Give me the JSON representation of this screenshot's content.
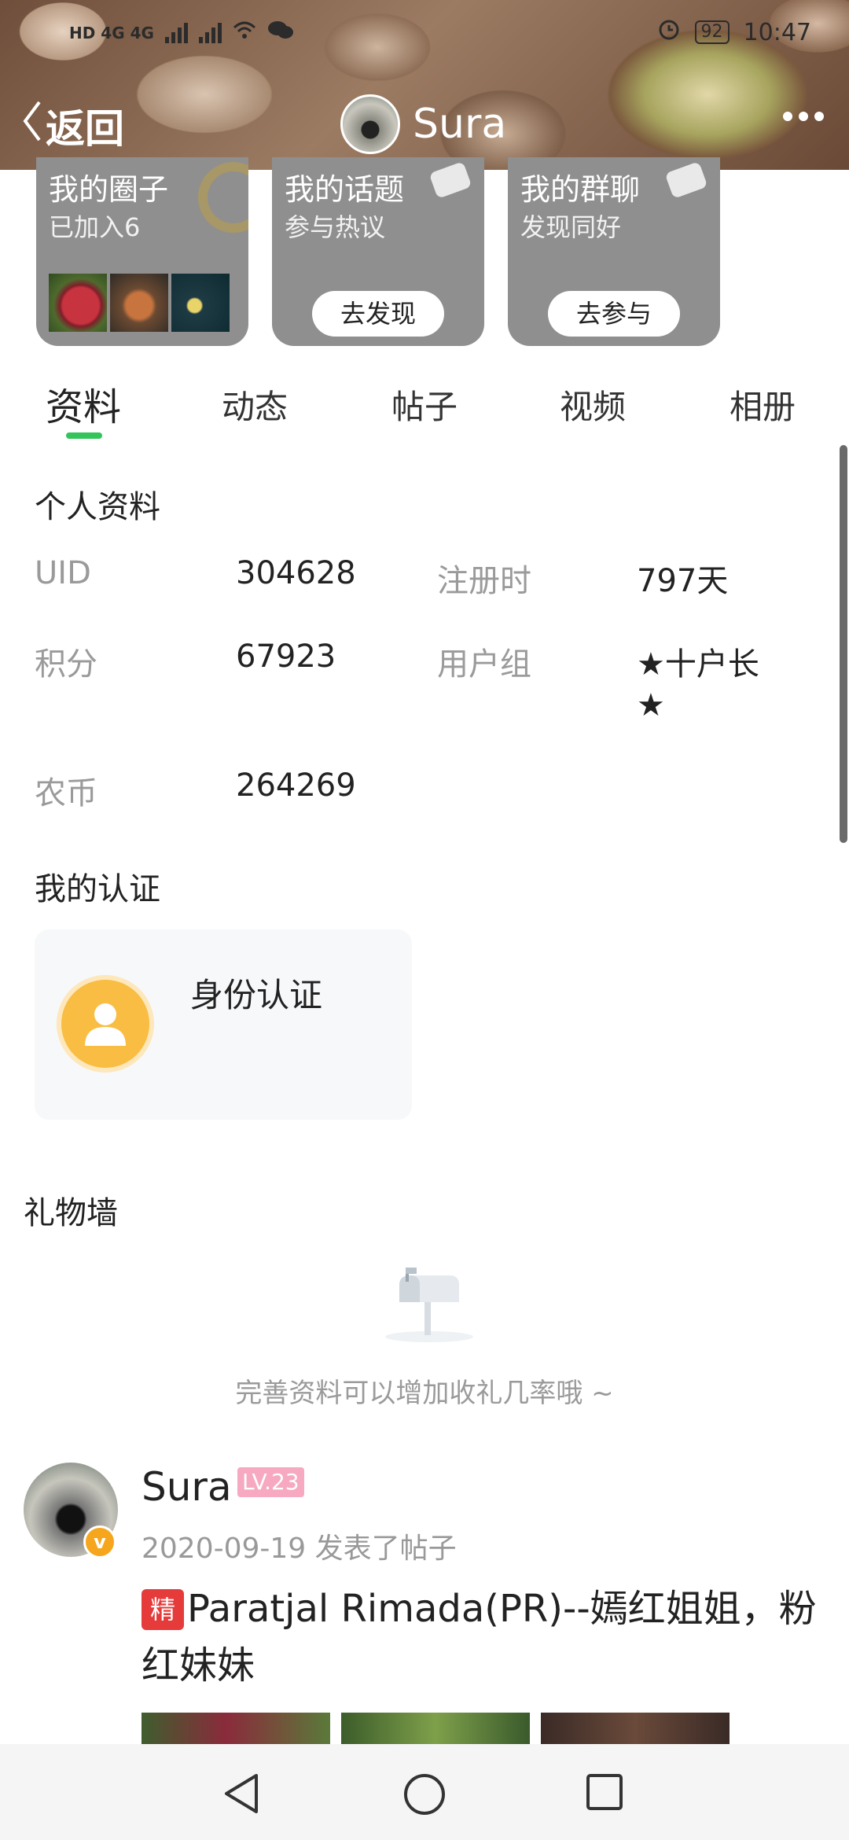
{
  "status_bar": {
    "left": "HD 4G 4G",
    "battery": "92",
    "time": "10:47"
  },
  "header": {
    "back_label": "返回",
    "username": "Sura"
  },
  "cards": [
    {
      "title": "我的圈子",
      "subtitle": "已加入6"
    },
    {
      "title": "我的话题",
      "subtitle": "参与热议",
      "button": "去发现"
    },
    {
      "title": "我的群聊",
      "subtitle": "发现同好",
      "button": "去参与"
    }
  ],
  "tabs": [
    "资料",
    "动态",
    "帖子",
    "视频",
    "相册"
  ],
  "profile": {
    "section_title": "个人资料",
    "uid_label": "UID",
    "uid_value": "304628",
    "reg_label": "注册时",
    "reg_value": "797天",
    "points_label": "积分",
    "points_value": "67923",
    "group_label": "用户组",
    "group_value_line1": "★十户长",
    "group_value_line2": "★",
    "coins_label": "农币",
    "coins_value": "264269"
  },
  "certification": {
    "section_title": "我的认证",
    "label": "身份认证"
  },
  "gift_wall": {
    "title": "礼物墙",
    "empty_text": "完善资料可以增加收礼几率哦 ~"
  },
  "post": {
    "author": "Sura",
    "level": "LV.23",
    "meta": "2020-09-19 发表了帖子",
    "tag": "精",
    "title": "Paratjal Rimada(PR)--嫣红姐姐，粉红妹妹"
  },
  "icons": {
    "back": "chevron-left-icon",
    "more": "more-dots-icon",
    "user": "user-icon",
    "mailbox": "mailbox-icon"
  },
  "colors": {
    "accent_green": "#33c45a",
    "card_gray": "#8f8f8f",
    "cert_orange": "#f8bd42",
    "level_pink": "#f6a9c0",
    "tag_red": "#e53b3b"
  }
}
